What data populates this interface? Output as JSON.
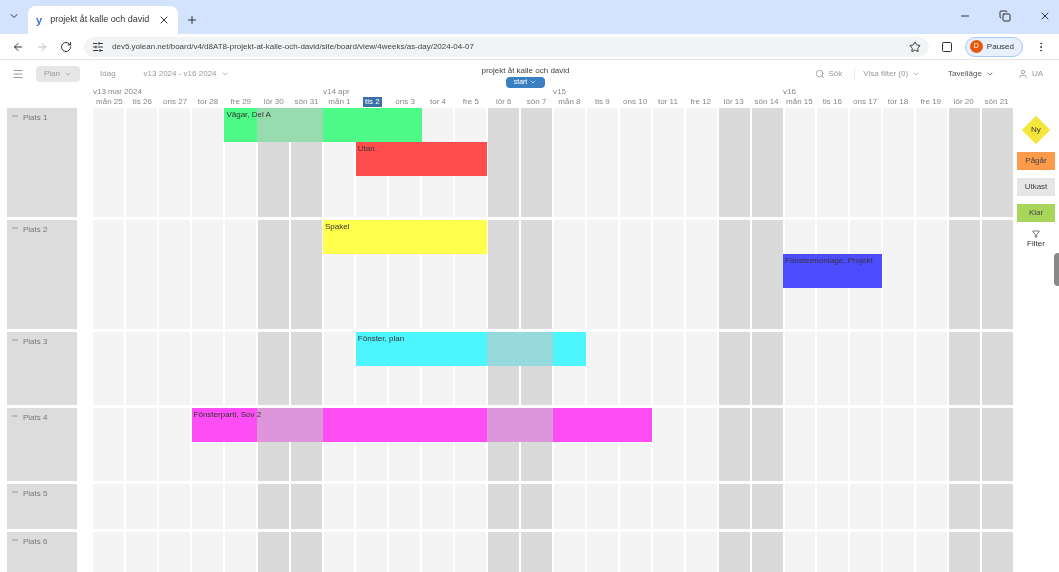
{
  "browser": {
    "logo": "y",
    "tab_title": "projekt åt kalle och david",
    "url": "dev5.yolean.net/board/v4/d8AT8-projekt-at-kalle-och-david/site/board/view/4weeks/as-day/2024-04-07",
    "profile": "Paused",
    "profile_initial": "D"
  },
  "toolbar": {
    "view_button": "Plan",
    "today_button": "Idag",
    "range": "v13 2024 - v16 2024",
    "board_title": "projekt åt kalle och david",
    "start_button": "start",
    "search": "Sök",
    "filter": "Visa filter (0)",
    "mode": "Tavelläge",
    "user": "UA"
  },
  "weeks": [
    {
      "label": "v13 mar 2024",
      "days": [
        {
          "label": "mån 25",
          "weekend": false,
          "selected": false
        },
        {
          "label": "tis 26",
          "weekend": false,
          "selected": false
        },
        {
          "label": "ons 27",
          "weekend": false,
          "selected": false
        },
        {
          "label": "tor 28",
          "weekend": false,
          "selected": false
        },
        {
          "label": "fre 29",
          "weekend": false,
          "selected": false
        },
        {
          "label": "lör 30",
          "weekend": true,
          "selected": false
        },
        {
          "label": "sön 31",
          "weekend": true,
          "selected": false
        }
      ]
    },
    {
      "label": "v14 apr",
      "days": [
        {
          "label": "mån 1",
          "weekend": false,
          "selected": false
        },
        {
          "label": "tis 2",
          "weekend": false,
          "selected": true
        },
        {
          "label": "ons 3",
          "weekend": false,
          "selected": false
        },
        {
          "label": "tor 4",
          "weekend": false,
          "selected": false
        },
        {
          "label": "fre 5",
          "weekend": false,
          "selected": false
        },
        {
          "label": "lör 6",
          "weekend": true,
          "selected": false
        },
        {
          "label": "sön 7",
          "weekend": true,
          "selected": false
        }
      ]
    },
    {
      "label": "v15",
      "days": [
        {
          "label": "mån 8",
          "weekend": false,
          "selected": false
        },
        {
          "label": "tis 9",
          "weekend": false,
          "selected": false
        },
        {
          "label": "ons 10",
          "weekend": false,
          "selected": false
        },
        {
          "label": "tor 11",
          "weekend": false,
          "selected": false
        },
        {
          "label": "fre 12",
          "weekend": false,
          "selected": false
        },
        {
          "label": "lör 13",
          "weekend": true,
          "selected": false
        },
        {
          "label": "sön 14",
          "weekend": true,
          "selected": false
        }
      ]
    },
    {
      "label": "v16",
      "days": [
        {
          "label": "mån 15",
          "weekend": false,
          "selected": false
        },
        {
          "label": "tis 16",
          "weekend": false,
          "selected": false
        },
        {
          "label": "ons 17",
          "weekend": false,
          "selected": false
        },
        {
          "label": "tor 18",
          "weekend": false,
          "selected": false
        },
        {
          "label": "fre 19",
          "weekend": false,
          "selected": false
        },
        {
          "label": "lör 20",
          "weekend": true,
          "selected": false
        },
        {
          "label": "sön 21",
          "weekend": true,
          "selected": false
        }
      ]
    }
  ],
  "rows": [
    {
      "label": "Plats 1",
      "events": [
        {
          "title": "Vägar, Del A",
          "color": "#4dfa87"
        },
        {
          "title": "Utan",
          "color": "#ff4d4d"
        }
      ]
    },
    {
      "label": "Plats 2",
      "events": [
        {
          "title": "Spakel",
          "color": "#ffff4d"
        },
        {
          "title": "Fönstermontage, Projekt",
          "color": "#4d4dff"
        }
      ]
    },
    {
      "label": "Plats 3",
      "events": [
        {
          "title": "Fönster, plan",
          "color": "#4df5ff"
        }
      ]
    },
    {
      "label": "Plats 4",
      "events": [
        {
          "title": "Fönsterparti, Sov 2",
          "color": "#ff4df5"
        }
      ]
    },
    {
      "label": "Plats 5",
      "events": []
    },
    {
      "label": "Plats 6",
      "events": []
    }
  ],
  "legend": [
    {
      "kind": "diamond",
      "label": "Ny",
      "color": "#f5e63b"
    },
    {
      "kind": "square",
      "label": "Pågår",
      "color": "#fb9a4b"
    },
    {
      "kind": "square",
      "label": "Utkast",
      "color": "#e6e6e6"
    },
    {
      "kind": "square",
      "label": "Klar",
      "color": "#a8d65a"
    },
    {
      "kind": "filter",
      "label": "Filter"
    }
  ]
}
